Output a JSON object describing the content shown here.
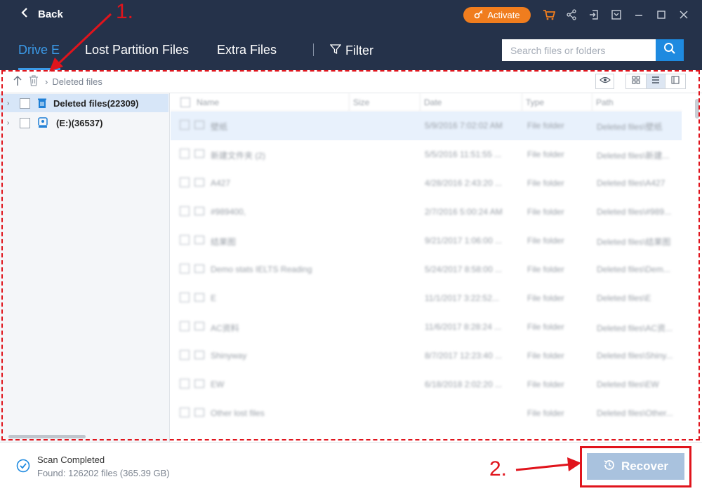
{
  "titlebar": {
    "back_label": "Back",
    "activate_label": "Activate",
    "icons": [
      "cart-icon",
      "share-icon",
      "signin-icon",
      "menu-icon",
      "minimize-icon",
      "maximize-icon",
      "close-icon"
    ],
    "accent_color": "#f07d1e"
  },
  "nav": {
    "tabs": [
      {
        "label": "Drive E",
        "active": true
      },
      {
        "label": "Lost Partition Files",
        "active": false
      },
      {
        "label": "Extra Files",
        "active": false
      }
    ],
    "filter_label": "Filter",
    "search_placeholder": "Search files or folders"
  },
  "toolbar": {
    "breadcrumb": "Deleted files"
  },
  "tree": {
    "items": [
      {
        "label": "Deleted files(22309)",
        "icon": "trash-icon",
        "selected": true
      },
      {
        "label": "(E:)(36537)",
        "icon": "drive-icon",
        "selected": false
      }
    ]
  },
  "filelist": {
    "columns": [
      "Name",
      "Size",
      "Date",
      "Type",
      "Path"
    ],
    "rows": [
      {
        "name": "壁纸",
        "date": "5/9/2016 7:02:02 AM",
        "type": "File folder",
        "path": "Deleted files\\壁纸"
      },
      {
        "name": "新建文件夹 (2)",
        "date": "5/5/2016 11:51:55 ...",
        "type": "File folder",
        "path": "Deleted files\\新建..."
      },
      {
        "name": "A427",
        "date": "4/28/2016 2:43:20 ...",
        "type": "File folder",
        "path": "Deleted files\\A427"
      },
      {
        "name": "#989400,",
        "date": "2/7/2016 5:00:24 AM",
        "type": "File folder",
        "path": "Deleted files\\#989..."
      },
      {
        "name": "结果图",
        "date": "9/21/2017 1:06:00 ...",
        "type": "File folder",
        "path": "Deleted files\\结果图"
      },
      {
        "name": "Demo stats IELTS Reading",
        "date": "5/24/2017 8:58:00 ...",
        "type": "File folder",
        "path": "Deleted files\\Dem..."
      },
      {
        "name": "E",
        "date": "11/1/2017 3:22:52...",
        "type": "File folder",
        "path": "Deleted files\\E"
      },
      {
        "name": "AC资料",
        "date": "11/6/2017 8:28:24 ...",
        "type": "File folder",
        "path": "Deleted files\\AC资..."
      },
      {
        "name": "Shinyway",
        "date": "8/7/2017 12:23:40 ...",
        "type": "File folder",
        "path": "Deleted files\\Shiny..."
      },
      {
        "name": "EW",
        "date": "6/18/2018 2:02:20 ...",
        "type": "File folder",
        "path": "Deleted files\\EW"
      },
      {
        "name": "Other lost files",
        "date": "",
        "type": "File folder",
        "path": "Deleted files\\Other..."
      }
    ]
  },
  "status": {
    "title": "Scan Completed",
    "subtitle": "Found: 126202 files (365.39 GB)",
    "recover_label": "Recover"
  },
  "annotations": {
    "step1": "1.",
    "step2": "2.",
    "color": "#e0141c"
  }
}
